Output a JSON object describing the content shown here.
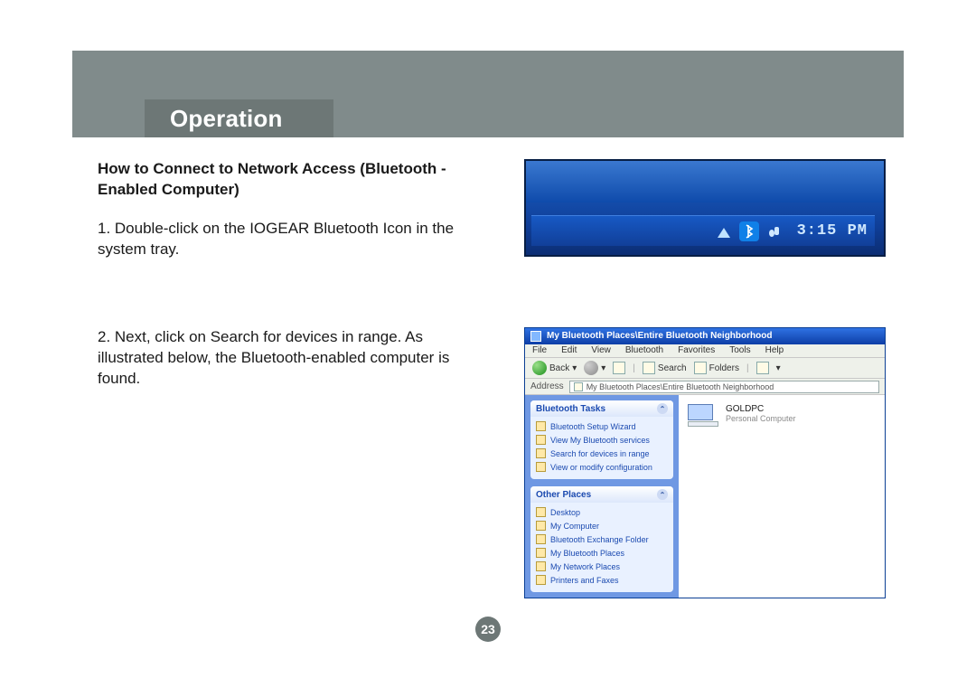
{
  "header": {
    "title": "Operation"
  },
  "section": {
    "heading": "How to Connect to Network Access (Bluetooth - Enabled Computer)",
    "step1": "1. Double-click on the IOGEAR Bluetooth Icon in the system tray.",
    "step2": "2. Next, click on Search for devices in range.  As illustrated below, the Bluetooth-enabled computer is found."
  },
  "systray": {
    "clock": "3:15 PM"
  },
  "explorer": {
    "title": "My Bluetooth Places\\Entire Bluetooth Neighborhood",
    "menus": [
      "File",
      "Edit",
      "View",
      "Bluetooth",
      "Favorites",
      "Tools",
      "Help"
    ],
    "toolbar": {
      "back": "Back",
      "search": "Search",
      "folders": "Folders"
    },
    "address_label": "Address",
    "address_value": "My Bluetooth Places\\Entire Bluetooth Neighborhood",
    "panel1": {
      "title": "Bluetooth Tasks",
      "items": [
        "Bluetooth Setup Wizard",
        "View My Bluetooth services",
        "Search for devices in range",
        "View or modify configuration"
      ]
    },
    "panel2": {
      "title": "Other Places",
      "items": [
        "Desktop",
        "My Computer",
        "Bluetooth Exchange Folder",
        "My Bluetooth Places",
        "My Network Places",
        "Printers and Faxes"
      ]
    },
    "device": {
      "name": "GOLDPC",
      "type": "Personal Computer"
    }
  },
  "page_number": "23"
}
